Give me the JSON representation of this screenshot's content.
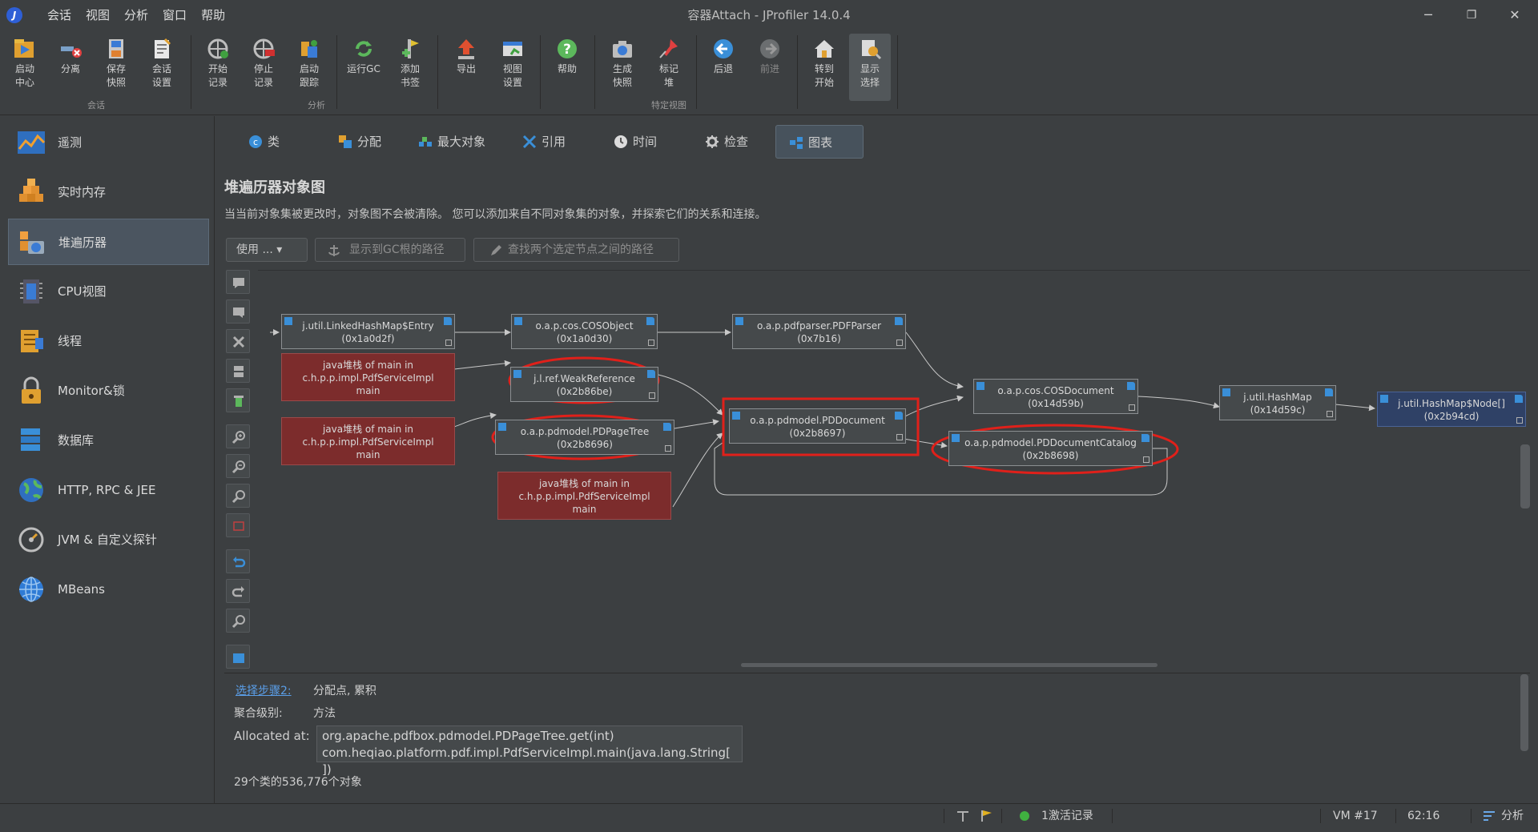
{
  "window": {
    "title": "容器Attach - JProfiler 14.0.4",
    "minimize": "─",
    "restore": "❐",
    "close": "✕"
  },
  "menu": [
    "会话",
    "视图",
    "分析",
    "窗口",
    "帮助"
  ],
  "toolbar": {
    "buttons": [
      {
        "label1": "启动",
        "label2": "中心"
      },
      {
        "label1": "分离",
        "label2": ""
      },
      {
        "label1": "保存",
        "label2": "快照"
      },
      {
        "label1": "会话",
        "label2": "设置"
      },
      {
        "label1": "开始",
        "label2": "记录"
      },
      {
        "label1": "停止",
        "label2": "记录"
      },
      {
        "label1": "启动",
        "label2": "跟踪"
      },
      {
        "label1": "运行GC",
        "label2": ""
      },
      {
        "label1": "添加",
        "label2": "书签"
      },
      {
        "label1": "导出",
        "label2": ""
      },
      {
        "label1": "视图",
        "label2": "设置"
      },
      {
        "label1": "帮助",
        "label2": ""
      },
      {
        "label1": "生成",
        "label2": "快照"
      },
      {
        "label1": "标记",
        "label2": "堆"
      },
      {
        "label1": "后退",
        "label2": ""
      },
      {
        "label1": "前进",
        "label2": ""
      },
      {
        "label1": "转到",
        "label2": "开始"
      },
      {
        "label1": "显示",
        "label2": "选择"
      }
    ],
    "groups": {
      "session": "会话",
      "analysis": "分析",
      "specific": "特定视图"
    }
  },
  "sidebar": {
    "items": [
      {
        "label": "遥测"
      },
      {
        "label": "实时内存"
      },
      {
        "label": "堆遍历器"
      },
      {
        "label": "CPU视图"
      },
      {
        "label": "线程"
      },
      {
        "label": "Monitor&锁"
      },
      {
        "label": "数据库"
      },
      {
        "label": "HTTP, RPC & JEE"
      },
      {
        "label": "JVM & 自定义探针"
      },
      {
        "label": "MBeans"
      }
    ],
    "active": "堆遍历器"
  },
  "tabs": [
    "类",
    "分配",
    "最大对象",
    "引用",
    "时间",
    "检查",
    "图表"
  ],
  "active_tab": "图表",
  "page": {
    "title": "堆遍历器对象图",
    "description": "当当前对象集被更改时，对象图不会被清除。 您可以添加来自不同对象集的对象，并探索它们的关系和连接。",
    "use_button": "使用 ... ▾",
    "gc_root_button": "显示到GC根的路径",
    "path_between_button": "查找两个选定节点之间的路径"
  },
  "graph": {
    "nodes": [
      {
        "id": "n1",
        "cls": "j.util.LinkedHashMap$Entry",
        "addr": "(0x1a0d2f)",
        "kind": "obj"
      },
      {
        "id": "n2",
        "cls": "o.a.p.cos.COSObject",
        "addr": "(0x1a0d30)",
        "kind": "obj"
      },
      {
        "id": "n3",
        "cls": "o.a.p.pdfparser.PDFParser",
        "addr": "(0x7b16)",
        "kind": "obj"
      },
      {
        "id": "s1",
        "line1": "java堆栈 of main in",
        "line2": "c.h.p.p.impl.PdfServiceImpl",
        "line3": "main",
        "kind": "stack"
      },
      {
        "id": "n4",
        "cls": "j.l.ref.WeakReference",
        "addr": "(0x2b86be)",
        "kind": "obj"
      },
      {
        "id": "n5",
        "cls": "o.a.p.cos.COSDocument",
        "addr": "(0x14d59b)",
        "kind": "obj"
      },
      {
        "id": "n6",
        "cls": "j.util.HashMap",
        "addr": "(0x14d59c)",
        "kind": "obj"
      },
      {
        "id": "n7",
        "cls": "j.util.HashMap$Node[]",
        "addr": "(0x2b94cd)",
        "kind": "arr"
      },
      {
        "id": "n8",
        "cls": "o.a.p.pdmodel.PDDocument",
        "addr": "(0x2b8697)",
        "kind": "obj"
      },
      {
        "id": "s2",
        "line1": "java堆栈 of main in",
        "line2": "c.h.p.p.impl.PdfServiceImpl",
        "line3": "main",
        "kind": "stack"
      },
      {
        "id": "n9",
        "cls": "o.a.p.pdmodel.PDPageTree",
        "addr": "(0x2b8696)",
        "kind": "obj"
      },
      {
        "id": "n10",
        "cls": "o.a.p.pdmodel.PDDocumentCatalog",
        "addr": "(0x2b8698)",
        "kind": "obj"
      },
      {
        "id": "s3",
        "line1": "java堆栈 of main in",
        "line2": "c.h.p.p.impl.PdfServiceImpl",
        "line3": "main",
        "kind": "stack"
      }
    ],
    "highlight_color": "#e0201a"
  },
  "info": {
    "select_step_link": "选择步骤2:",
    "select_step_value": "分配点, 累积",
    "agg_label": "聚合级别:",
    "agg_value": "方法",
    "allocated_label": "Allocated at:",
    "allocated_lines": [
      "org.apache.pdfbox.pdmodel.PDPageTree.get(int)",
      "com.heqiao.platform.pdf.impl.PdfServiceImpl.main(java.lang.String[ ])"
    ],
    "summary": "29个类的536,776个对象"
  },
  "status": {
    "recordings": "1激活记录",
    "vm": "VM #17",
    "time": "62:16",
    "mode": "分析"
  }
}
